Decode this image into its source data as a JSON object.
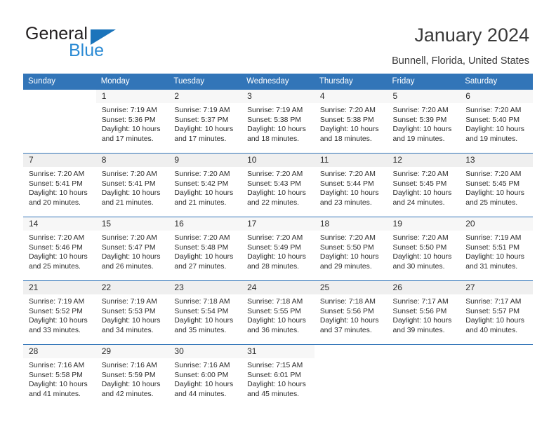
{
  "brand": {
    "name_part1": "General",
    "name_part2": "Blue",
    "color_primary": "#2a8ad4",
    "color_dark": "#231f20"
  },
  "header": {
    "title": "January 2024",
    "subtitle": "Bunnell, Florida, United States"
  },
  "theme": {
    "header_bg": "#3275b8",
    "header_text": "#ffffff",
    "row_border": "#3275b8",
    "daynum_bg_light": "#f7f7f7",
    "daynum_bg_shaded": "#efefef"
  },
  "weekday_headers": [
    "Sunday",
    "Monday",
    "Tuesday",
    "Wednesday",
    "Thursday",
    "Friday",
    "Saturday"
  ],
  "weeks": [
    {
      "shaded": false,
      "days": [
        {
          "empty": true
        },
        {
          "day": "1",
          "sunrise": "Sunrise: 7:19 AM",
          "sunset": "Sunset: 5:36 PM",
          "daylight1": "Daylight: 10 hours",
          "daylight2": "and 17 minutes."
        },
        {
          "day": "2",
          "sunrise": "Sunrise: 7:19 AM",
          "sunset": "Sunset: 5:37 PM",
          "daylight1": "Daylight: 10 hours",
          "daylight2": "and 17 minutes."
        },
        {
          "day": "3",
          "sunrise": "Sunrise: 7:19 AM",
          "sunset": "Sunset: 5:38 PM",
          "daylight1": "Daylight: 10 hours",
          "daylight2": "and 18 minutes."
        },
        {
          "day": "4",
          "sunrise": "Sunrise: 7:20 AM",
          "sunset": "Sunset: 5:38 PM",
          "daylight1": "Daylight: 10 hours",
          "daylight2": "and 18 minutes."
        },
        {
          "day": "5",
          "sunrise": "Sunrise: 7:20 AM",
          "sunset": "Sunset: 5:39 PM",
          "daylight1": "Daylight: 10 hours",
          "daylight2": "and 19 minutes."
        },
        {
          "day": "6",
          "sunrise": "Sunrise: 7:20 AM",
          "sunset": "Sunset: 5:40 PM",
          "daylight1": "Daylight: 10 hours",
          "daylight2": "and 19 minutes."
        }
      ]
    },
    {
      "shaded": true,
      "days": [
        {
          "day": "7",
          "sunrise": "Sunrise: 7:20 AM",
          "sunset": "Sunset: 5:41 PM",
          "daylight1": "Daylight: 10 hours",
          "daylight2": "and 20 minutes."
        },
        {
          "day": "8",
          "sunrise": "Sunrise: 7:20 AM",
          "sunset": "Sunset: 5:41 PM",
          "daylight1": "Daylight: 10 hours",
          "daylight2": "and 21 minutes."
        },
        {
          "day": "9",
          "sunrise": "Sunrise: 7:20 AM",
          "sunset": "Sunset: 5:42 PM",
          "daylight1": "Daylight: 10 hours",
          "daylight2": "and 21 minutes."
        },
        {
          "day": "10",
          "sunrise": "Sunrise: 7:20 AM",
          "sunset": "Sunset: 5:43 PM",
          "daylight1": "Daylight: 10 hours",
          "daylight2": "and 22 minutes."
        },
        {
          "day": "11",
          "sunrise": "Sunrise: 7:20 AM",
          "sunset": "Sunset: 5:44 PM",
          "daylight1": "Daylight: 10 hours",
          "daylight2": "and 23 minutes."
        },
        {
          "day": "12",
          "sunrise": "Sunrise: 7:20 AM",
          "sunset": "Sunset: 5:45 PM",
          "daylight1": "Daylight: 10 hours",
          "daylight2": "and 24 minutes."
        },
        {
          "day": "13",
          "sunrise": "Sunrise: 7:20 AM",
          "sunset": "Sunset: 5:45 PM",
          "daylight1": "Daylight: 10 hours",
          "daylight2": "and 25 minutes."
        }
      ]
    },
    {
      "shaded": false,
      "days": [
        {
          "day": "14",
          "sunrise": "Sunrise: 7:20 AM",
          "sunset": "Sunset: 5:46 PM",
          "daylight1": "Daylight: 10 hours",
          "daylight2": "and 25 minutes."
        },
        {
          "day": "15",
          "sunrise": "Sunrise: 7:20 AM",
          "sunset": "Sunset: 5:47 PM",
          "daylight1": "Daylight: 10 hours",
          "daylight2": "and 26 minutes."
        },
        {
          "day": "16",
          "sunrise": "Sunrise: 7:20 AM",
          "sunset": "Sunset: 5:48 PM",
          "daylight1": "Daylight: 10 hours",
          "daylight2": "and 27 minutes."
        },
        {
          "day": "17",
          "sunrise": "Sunrise: 7:20 AM",
          "sunset": "Sunset: 5:49 PM",
          "daylight1": "Daylight: 10 hours",
          "daylight2": "and 28 minutes."
        },
        {
          "day": "18",
          "sunrise": "Sunrise: 7:20 AM",
          "sunset": "Sunset: 5:50 PM",
          "daylight1": "Daylight: 10 hours",
          "daylight2": "and 29 minutes."
        },
        {
          "day": "19",
          "sunrise": "Sunrise: 7:20 AM",
          "sunset": "Sunset: 5:50 PM",
          "daylight1": "Daylight: 10 hours",
          "daylight2": "and 30 minutes."
        },
        {
          "day": "20",
          "sunrise": "Sunrise: 7:19 AM",
          "sunset": "Sunset: 5:51 PM",
          "daylight1": "Daylight: 10 hours",
          "daylight2": "and 31 minutes."
        }
      ]
    },
    {
      "shaded": true,
      "days": [
        {
          "day": "21",
          "sunrise": "Sunrise: 7:19 AM",
          "sunset": "Sunset: 5:52 PM",
          "daylight1": "Daylight: 10 hours",
          "daylight2": "and 33 minutes."
        },
        {
          "day": "22",
          "sunrise": "Sunrise: 7:19 AM",
          "sunset": "Sunset: 5:53 PM",
          "daylight1": "Daylight: 10 hours",
          "daylight2": "and 34 minutes."
        },
        {
          "day": "23",
          "sunrise": "Sunrise: 7:18 AM",
          "sunset": "Sunset: 5:54 PM",
          "daylight1": "Daylight: 10 hours",
          "daylight2": "and 35 minutes."
        },
        {
          "day": "24",
          "sunrise": "Sunrise: 7:18 AM",
          "sunset": "Sunset: 5:55 PM",
          "daylight1": "Daylight: 10 hours",
          "daylight2": "and 36 minutes."
        },
        {
          "day": "25",
          "sunrise": "Sunrise: 7:18 AM",
          "sunset": "Sunset: 5:56 PM",
          "daylight1": "Daylight: 10 hours",
          "daylight2": "and 37 minutes."
        },
        {
          "day": "26",
          "sunrise": "Sunrise: 7:17 AM",
          "sunset": "Sunset: 5:56 PM",
          "daylight1": "Daylight: 10 hours",
          "daylight2": "and 39 minutes."
        },
        {
          "day": "27",
          "sunrise": "Sunrise: 7:17 AM",
          "sunset": "Sunset: 5:57 PM",
          "daylight1": "Daylight: 10 hours",
          "daylight2": "and 40 minutes."
        }
      ]
    },
    {
      "shaded": false,
      "days": [
        {
          "day": "28",
          "sunrise": "Sunrise: 7:16 AM",
          "sunset": "Sunset: 5:58 PM",
          "daylight1": "Daylight: 10 hours",
          "daylight2": "and 41 minutes."
        },
        {
          "day": "29",
          "sunrise": "Sunrise: 7:16 AM",
          "sunset": "Sunset: 5:59 PM",
          "daylight1": "Daylight: 10 hours",
          "daylight2": "and 42 minutes."
        },
        {
          "day": "30",
          "sunrise": "Sunrise: 7:16 AM",
          "sunset": "Sunset: 6:00 PM",
          "daylight1": "Daylight: 10 hours",
          "daylight2": "and 44 minutes."
        },
        {
          "day": "31",
          "sunrise": "Sunrise: 7:15 AM",
          "sunset": "Sunset: 6:01 PM",
          "daylight1": "Daylight: 10 hours",
          "daylight2": "and 45 minutes."
        },
        {
          "empty": true
        },
        {
          "empty": true
        },
        {
          "empty": true
        }
      ]
    }
  ]
}
